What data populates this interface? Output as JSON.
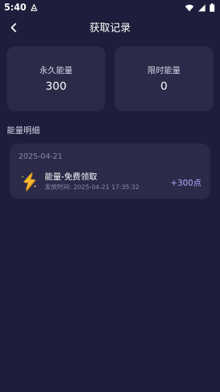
{
  "status_bar": {
    "time": "5:40"
  },
  "header": {
    "title": "获取记录"
  },
  "stats": [
    {
      "label": "永久能量",
      "value": "300"
    },
    {
      "label": "限时能量",
      "value": "0"
    }
  ],
  "section": {
    "title": "能量明细"
  },
  "records": [
    {
      "date": "2025-04-21",
      "title": "能量-免费领取",
      "time_prefix": "发放时间:",
      "time": "2025-04-21 17:35:32",
      "amount": "+300点",
      "icon": "lightning-bolt-icon"
    }
  ],
  "colors": {
    "background": "#1e1e3c",
    "card": "#2b2b49",
    "accent": "#b7a5ff",
    "bolt": "#f5b82e"
  }
}
